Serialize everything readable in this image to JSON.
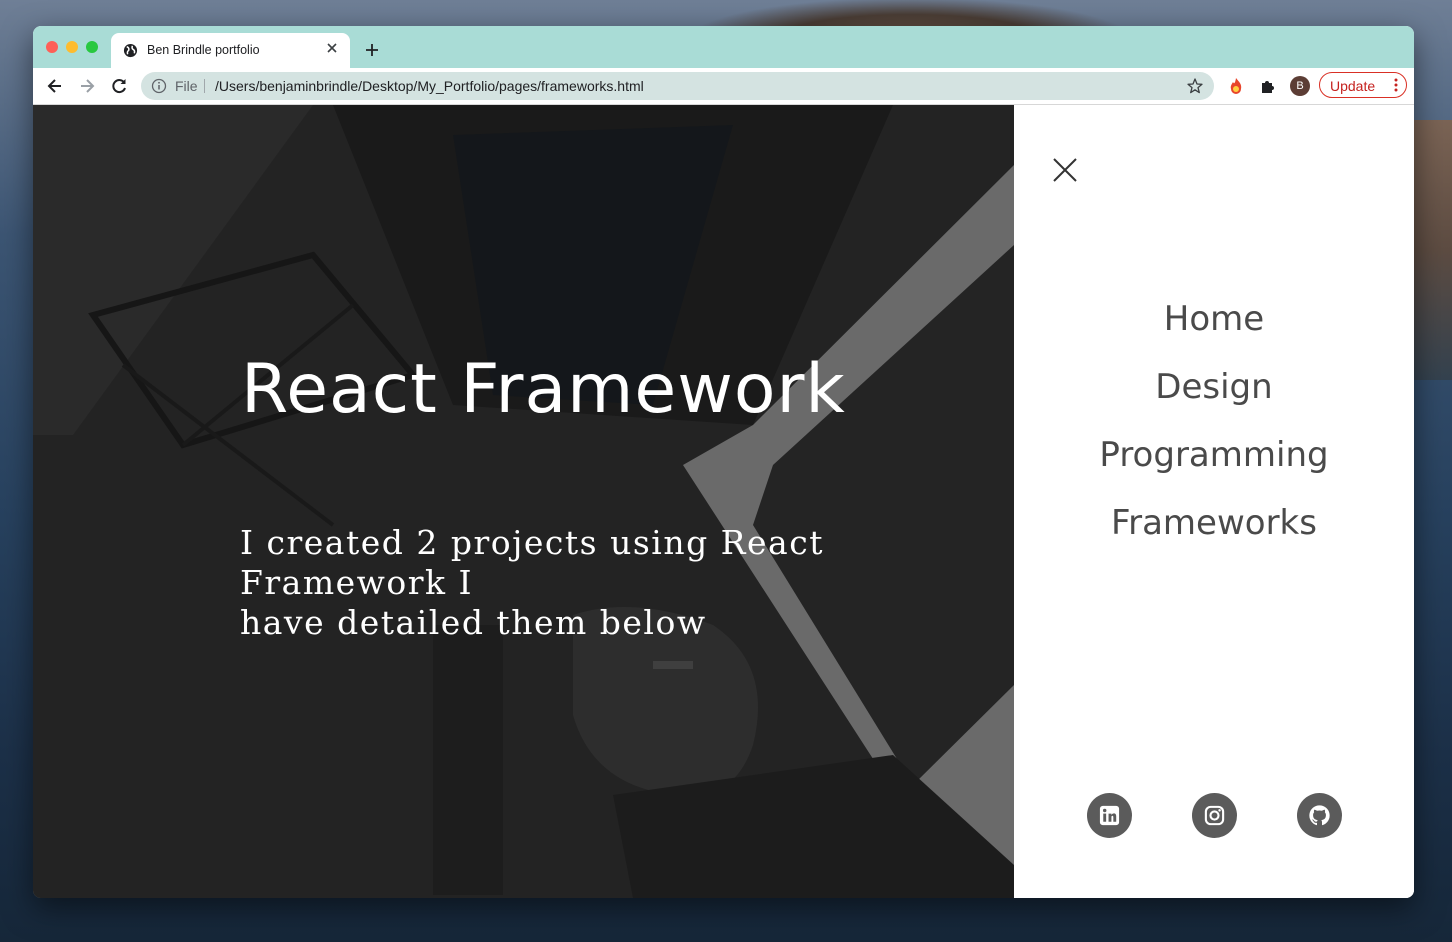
{
  "browser": {
    "tab": {
      "title": "Ben Brindle portfolio"
    },
    "address": {
      "scheme_label": "File",
      "url": "/Users/benjaminbrindle/Desktop/My_Portfolio/pages/frameworks.html"
    },
    "profile_initial": "B",
    "update_label": "Update"
  },
  "hero": {
    "title": "React Framework",
    "subtitle": "I created 2 projects using React Framework I\nhave detailed them below"
  },
  "side_menu": {
    "items": [
      {
        "label": "Home"
      },
      {
        "label": "Design"
      },
      {
        "label": "Programming"
      },
      {
        "label": "Frameworks"
      }
    ],
    "social": [
      "linkedin-icon",
      "instagram-icon",
      "github-icon"
    ]
  },
  "colors": {
    "tab_strip": "#a9dcd6",
    "omnibox": "#d4e3e1",
    "update_accent": "#d93025",
    "social_circle": "#5b5b5b",
    "nav_text": "#4a4a4a"
  }
}
